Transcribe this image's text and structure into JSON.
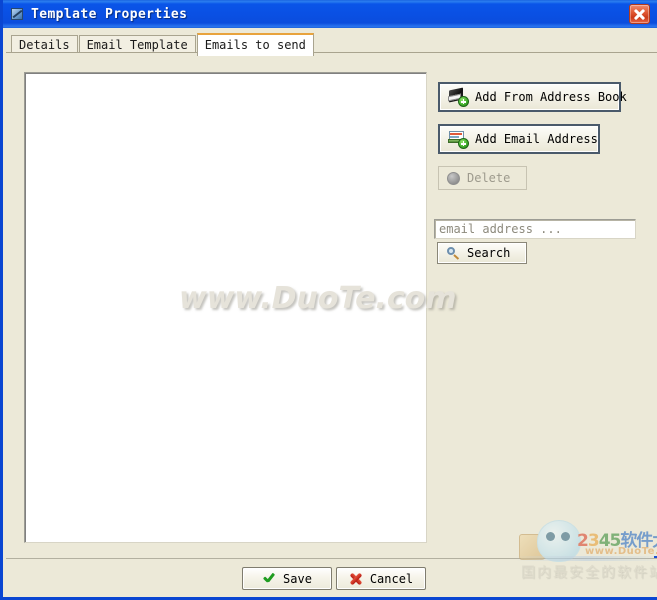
{
  "window": {
    "title": "Template Properties",
    "title_icon": "window-app-icon",
    "close_label": "×",
    "titlebar_color": "#0a50e4",
    "dialog_background": "#ece9d8"
  },
  "tabs": [
    {
      "label": "Details",
      "active": false
    },
    {
      "label": "Email Template",
      "active": false
    },
    {
      "label": "Emails to send",
      "active": true
    }
  ],
  "main": {
    "list": {
      "items": [],
      "empty": true,
      "background": "#ffffff"
    }
  },
  "sidebar": {
    "buttons": [
      {
        "label": "Add From Address Book",
        "icon": "address-book-add-icon",
        "enabled": true
      },
      {
        "label": "Add Email Address",
        "icon": "email-card-add-icon",
        "enabled": true
      },
      {
        "label": "Delete",
        "icon": "delete-circle-icon",
        "enabled": false
      }
    ],
    "search": {
      "value": "",
      "placeholder": "email address ...",
      "button_label": "Search",
      "button_icon": "magnifier-icon"
    }
  },
  "footer": {
    "buttons": [
      {
        "label": "Save",
        "icon": "green-check-icon"
      },
      {
        "label": "Cancel",
        "icon": "red-x-icon"
      }
    ]
  },
  "watermarks": {
    "center_text": "www.DuoTe.com",
    "logo": {
      "brand_digits_2": "2",
      "brand_digits_3": "3",
      "brand_digits_45": "45",
      "brand_cn": "软件大全",
      "url": "www.DuoTe.com",
      "tagline": "国内最安全的软件站"
    }
  }
}
